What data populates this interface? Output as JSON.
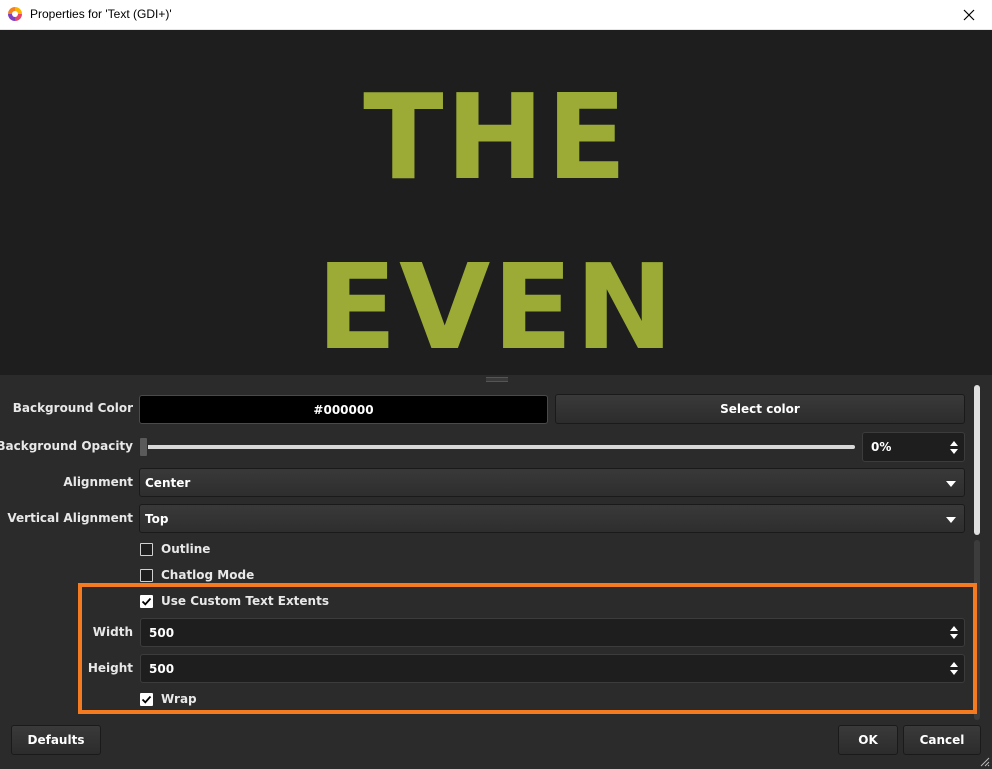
{
  "window": {
    "title": "Properties for 'Text (GDI+)'"
  },
  "preview": {
    "line1": "THE",
    "line2": "EVEN",
    "text_color": "#9bab35"
  },
  "properties": {
    "background_color": {
      "label": "Background Color",
      "value": "#000000",
      "button": "Select color"
    },
    "background_opacity": {
      "label": "Background Opacity",
      "value": "0%",
      "level": 0
    },
    "alignment": {
      "label": "Alignment",
      "value": "Center"
    },
    "vertical_alignment": {
      "label": "Vertical Alignment",
      "value": "Top"
    },
    "outline": {
      "label": "Outline",
      "checked": false
    },
    "chatlog_mode": {
      "label": "Chatlog Mode",
      "checked": false
    },
    "use_custom_text_extents": {
      "label": "Use Custom Text Extents",
      "checked": true
    },
    "width": {
      "label": "Width",
      "value": "500"
    },
    "height": {
      "label": "Height",
      "value": "500"
    },
    "wrap": {
      "label": "Wrap",
      "checked": true
    }
  },
  "footer": {
    "defaults": "Defaults",
    "ok": "OK",
    "cancel": "Cancel"
  },
  "colors": {
    "highlight": "#f47b20",
    "preview_bg": "#1e1e1e",
    "panel_bg": "#2b2b2b"
  }
}
